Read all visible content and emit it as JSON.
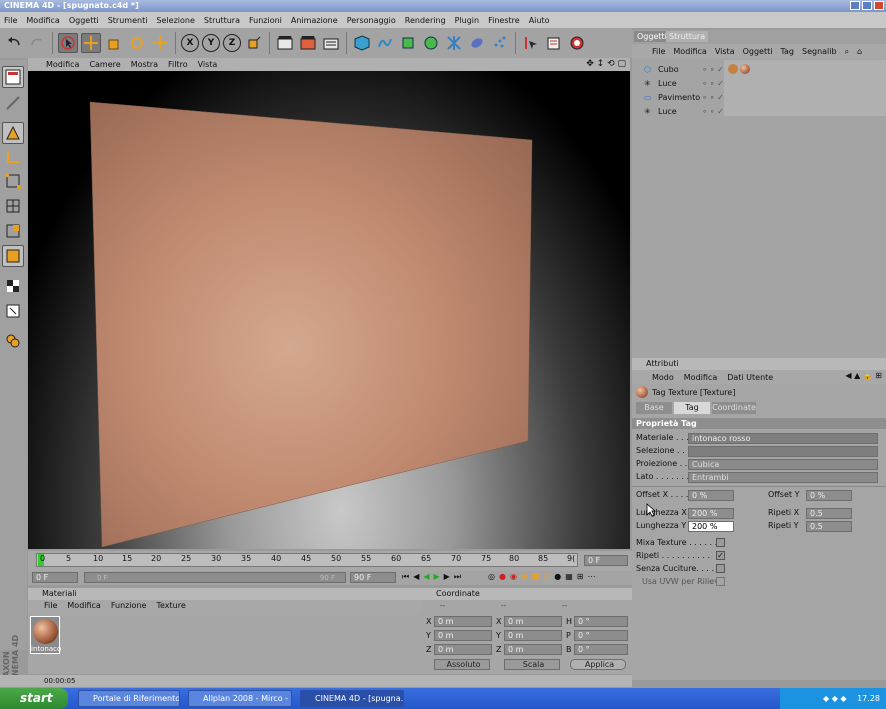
{
  "window": {
    "title": "CINEMA 4D - [spugnato.c4d *]"
  },
  "menu": [
    "File",
    "Modifica",
    "Oggetti",
    "Strumenti",
    "Selezione",
    "Struttura",
    "Funzioni",
    "Animazione",
    "Personaggio",
    "Rendering",
    "Plugin",
    "Finestre",
    "Aiuto"
  ],
  "toolbar_icons": [
    "undo-icon",
    "redo-icon",
    "select-arrow-icon",
    "move-icon",
    "scale-icon",
    "rotate-icon",
    "axis-move-icon",
    "x-axis-icon",
    "y-axis-icon",
    "z-axis-icon",
    "coord-system-icon",
    "render-view-icon",
    "render-picture-icon",
    "render-settings-icon",
    "cube-icon",
    "spline-icon",
    "nurbs-icon",
    "array-icon",
    "deformer-icon",
    "scene-icon",
    "particle-icon",
    "camera-tool-icon",
    "settings-tool-icon",
    "light-tool-icon"
  ],
  "toolbar_xyz": {
    "x": "X",
    "y": "Y",
    "z": "Z"
  },
  "viewport": {
    "menu": [
      "Modifica",
      "Camere",
      "Mostra",
      "Filtro",
      "Vista"
    ]
  },
  "timeline": {
    "ticks": [
      "0",
      "5",
      "10",
      "15",
      "20",
      "25",
      "30",
      "35",
      "40",
      "45",
      "50",
      "55",
      "60",
      "65",
      "70",
      "75",
      "80",
      "85",
      "9("
    ],
    "frame_field": "0 F",
    "start_field": "0 F",
    "slider_start": "0 F",
    "slider_end": "90 F",
    "end_field": "90 F"
  },
  "materials": {
    "title": "Materiali",
    "menu": [
      "File",
      "Modifica",
      "Funzione",
      "Texture"
    ],
    "items": [
      {
        "name": "intonaco"
      }
    ]
  },
  "coordinates": {
    "title": "Coordinate",
    "col_headers": [
      "--",
      "--",
      "--"
    ],
    "rows": [
      {
        "a": "X",
        "av": "0 m",
        "b": "X",
        "bv": "0 m",
        "c": "H",
        "cv": "0 °"
      },
      {
        "a": "Y",
        "av": "0 m",
        "b": "Y",
        "bv": "0 m",
        "c": "P",
        "cv": "0 °"
      },
      {
        "a": "Z",
        "av": "0 m",
        "b": "Z",
        "bv": "0 m",
        "c": "B",
        "cv": "0 °"
      }
    ],
    "mode": "Assoluto",
    "scale": "Scala",
    "apply": "Applica"
  },
  "objects": {
    "tabs": [
      "Oggetti",
      "Struttura"
    ],
    "menu": [
      "File",
      "Modifica",
      "Vista",
      "Oggetti",
      "Tag",
      "Segnalib"
    ],
    "items": [
      "Cubo",
      "Luce",
      "Pavimento",
      "Luce"
    ]
  },
  "attributes": {
    "title": "Attributi",
    "menu": [
      "Modo",
      "Modifica",
      "Dati Utente"
    ],
    "object_name": "Tag Texture [Texture]",
    "tabs": [
      "Base",
      "Tag",
      "Coordinate"
    ],
    "section": "Proprietà Tag",
    "materiale_label": "Materiale . . .",
    "materiale_value": "intonaco rosso",
    "selezione_label": "Selezione . . .",
    "proiezione_label": "Proiezione . .",
    "proiezione_value": "Cubica",
    "lato_label": "Lato . . . . . . .",
    "lato_value": "Entrambi",
    "offset_x_label": "Offset X . . . .",
    "offset_x_value": "0 %",
    "offset_y_label": "Offset Y",
    "offset_y_value": "0 %",
    "lung_x_label": "Lunghezza X",
    "lung_x_value": "200 %",
    "ripeti_x_label": "Ripeti X",
    "ripeti_x_value": "0.5",
    "lung_y_label": "Lunghezza Y",
    "lung_y_value": "200 %",
    "ripeti_y_label": "Ripeti Y",
    "ripeti_y_value": "0.5",
    "mixa_label": "Mixa Texture . . . . . .",
    "ripeti_label": "Ripeti . . . . . . . . . .",
    "senza_label": "Senza Cuciture. . . . .",
    "uvw_label": "Usa UVW per Rilievo"
  },
  "status": {
    "time": "00:00:05"
  },
  "brand": "MAXON CINEMA 4D",
  "taskbar": {
    "start": "start",
    "tasks": [
      "Portale di Riferimento...",
      "Allplan 2008 - Mirco - ...",
      "CINEMA 4D - [spugna..."
    ],
    "clock": "17.28"
  }
}
